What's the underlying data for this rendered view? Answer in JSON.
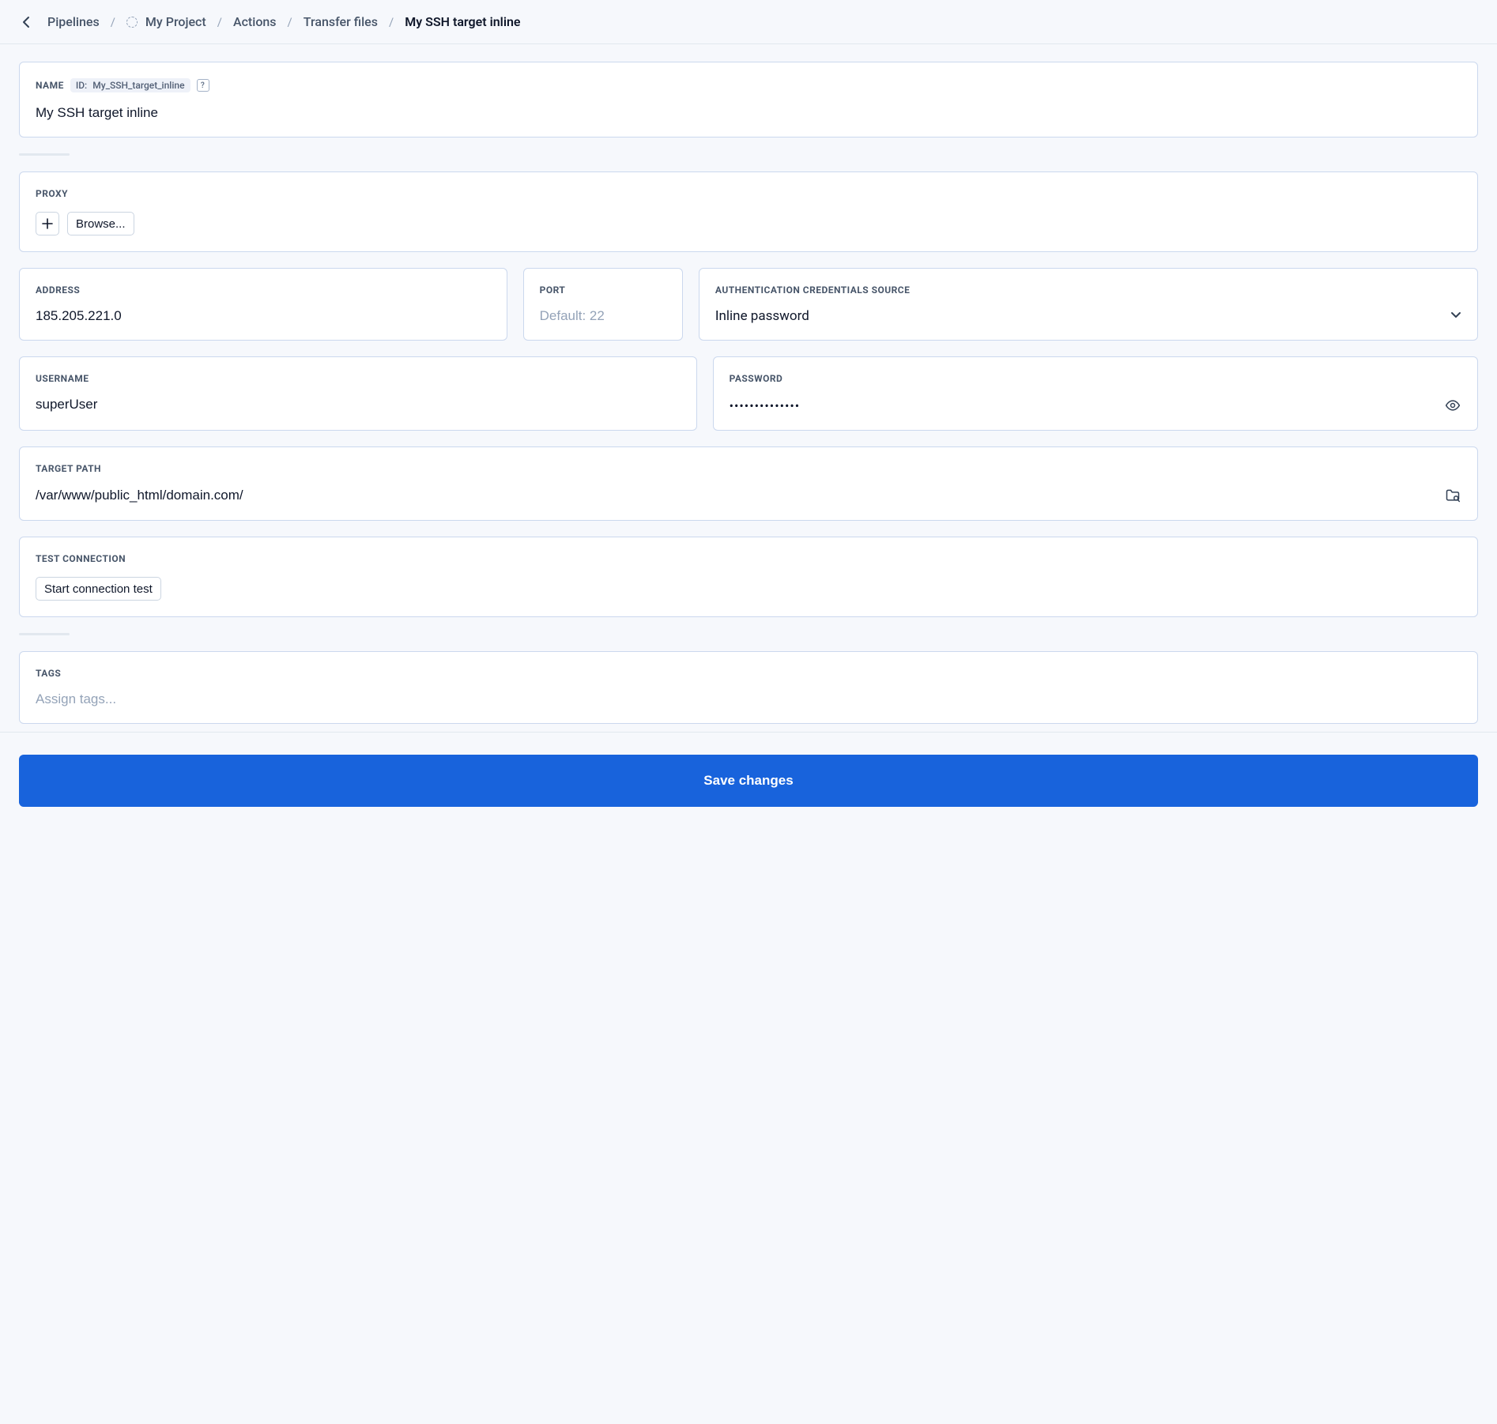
{
  "breadcrumb": {
    "back_aria": "Back",
    "items": [
      {
        "label": "Pipelines",
        "has_icon": false
      },
      {
        "label": "My Project",
        "has_icon": true
      },
      {
        "label": "Actions",
        "has_icon": false
      },
      {
        "label": "Transfer files",
        "has_icon": false
      }
    ],
    "current": "My SSH target inline"
  },
  "name_section": {
    "label": "NAME",
    "id_label": "ID:",
    "id_value": "My_SSH_target_inline",
    "help": "?",
    "value": "My SSH target inline"
  },
  "proxy": {
    "label": "PROXY",
    "add_aria": "Add proxy",
    "browse_label": "Browse..."
  },
  "address": {
    "label": "ADDRESS",
    "value": "185.205.221.0"
  },
  "port": {
    "label": "PORT",
    "placeholder": "Default: 22",
    "value": ""
  },
  "auth": {
    "label": "AUTHENTICATION CREDENTIALS SOURCE",
    "value": "Inline password"
  },
  "username": {
    "label": "USERNAME",
    "value": "superUser"
  },
  "password": {
    "label": "PASSWORD",
    "masked_value": "••••••••••••••",
    "toggle_aria": "Show password"
  },
  "target_path": {
    "label": "TARGET PATH",
    "value": "/var/www/public_html/domain.com/",
    "browse_aria": "Browse path"
  },
  "test": {
    "label": "TEST CONNECTION",
    "button_label": "Start connection test"
  },
  "tags": {
    "label": "TAGS",
    "placeholder": "Assign tags...",
    "value": ""
  },
  "footer": {
    "save_label": "Save changes"
  }
}
